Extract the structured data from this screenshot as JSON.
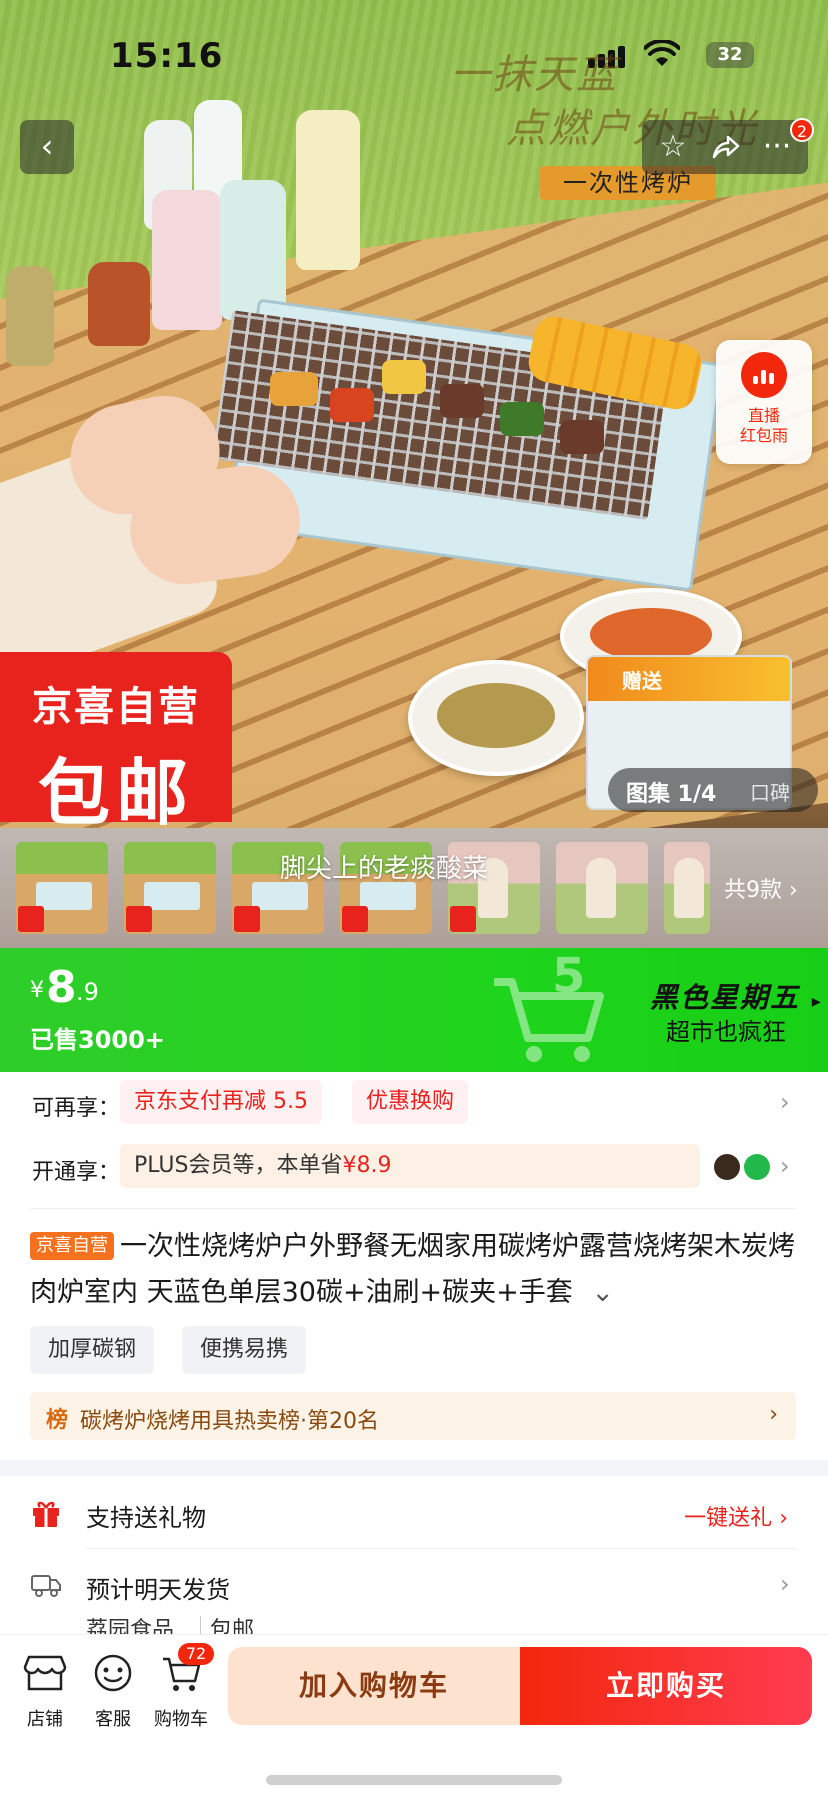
{
  "status_bar": {
    "time": "15:16",
    "battery": "32"
  },
  "hero": {
    "title": "一抹天蓝",
    "subtitle": "点燃户外时光",
    "tag": "一次性烤炉",
    "promo_line1": "京喜自营",
    "promo_line2": "包邮",
    "gift_label": "赠送",
    "gallery_label": "图集 1/4",
    "reviews_label": "口碑",
    "more_badge": "2",
    "live_label_line1": "直播",
    "live_label_line2": "红包雨"
  },
  "variants": {
    "overlay_text": "脚尖上的老痰酸菜",
    "count_label": "共9款",
    "thumbs": [
      "product",
      "product",
      "product",
      "product",
      "person",
      "person",
      "person",
      "person"
    ]
  },
  "price_banner": {
    "currency": "¥",
    "price_int": "8",
    "price_dec": ".9",
    "sold": "已售3000+",
    "event_title": "黑色星期五",
    "event_sub": "超市也疯狂"
  },
  "benefits": {
    "row1_label": "可再享：",
    "row1_chips": [
      "京东支付再减 5.5",
      "优惠换购"
    ],
    "row2_label": "开通享：",
    "row2_text": "PLUS会员等，本单省",
    "row2_amount": "¥8.9"
  },
  "product": {
    "badge": "京喜自营",
    "title": "一次性烧烤炉户外野餐无烟家用碳烤炉露营烧烤架木炭烤肉炉室内 天蓝色单层30碳+油刷+碳夹+手套",
    "tags": [
      "加厚碳钢",
      "便携易携"
    ],
    "rank_icon": "榜",
    "rank_text": "碳烤炉烧烤用具热卖榜·第20名"
  },
  "services": {
    "gift_label": "支持送礼物",
    "gift_link": "一键送礼",
    "ship_label": "预计明天发货",
    "ship_sub1": "荔园食品",
    "ship_sub2": "包邮"
  },
  "bottom_bar": {
    "store": "店铺",
    "service": "客服",
    "cart": "购物车",
    "cart_count": "72",
    "add_cart": "加入购物车",
    "buy_now": "立即购买"
  },
  "colors": {
    "brand_red": "#f2270c",
    "promo_green": "#1fd41c",
    "jx_orange": "#f6711d"
  }
}
